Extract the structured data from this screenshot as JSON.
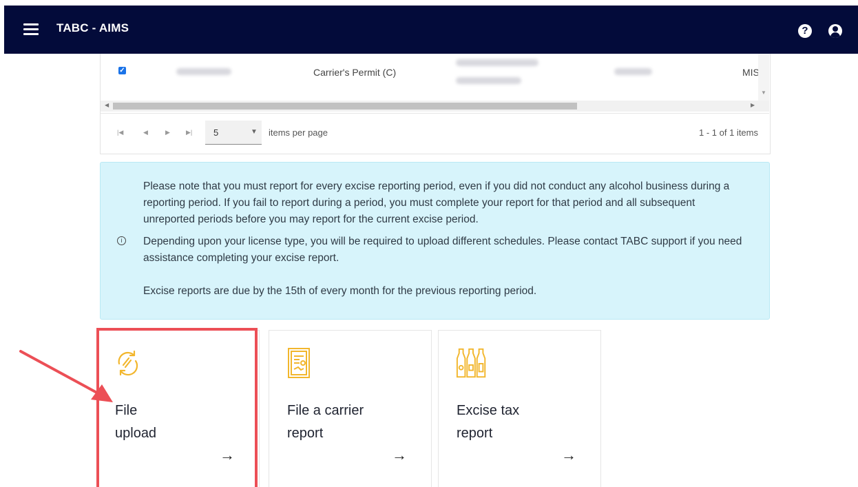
{
  "header": {
    "title": "TABC - AIMS",
    "help_icon": "?",
    "menu_icon": "hamburger-icon",
    "user_icon": "user-circle-icon"
  },
  "grid": {
    "row": {
      "checked": true,
      "permit_type": "Carrier's Permit (C)",
      "truncated_cell": "MIS"
    },
    "pager": {
      "page_size": "5",
      "items_per_page_label": "items per page",
      "count_label": "1 - 1 of 1 items"
    }
  },
  "notice": {
    "paragraphs": [
      "Please note that you must report for every excise reporting period, even if you did not conduct any alcohol business during a reporting period. If you fail to report during a period, you must complete your report for that period and all subsequent unreported periods before you may report for the current excise period.",
      "Depending upon your license type, you will be required to upload different schedules. Please contact TABC support if you need assistance completing your excise report.",
      "Excise reports are due by the 15th of every month for the previous reporting period."
    ]
  },
  "cards": [
    {
      "label": "File upload",
      "icon": "sync-arrows-icon",
      "arrow": "→"
    },
    {
      "label": "File a carrier report",
      "icon": "certificate-icon",
      "arrow": "→"
    },
    {
      "label": "Excise tax report",
      "icon": "bottles-icon",
      "arrow": "→"
    }
  ],
  "colors": {
    "header_bg": "#030b3a",
    "notice_bg": "#d7f4fb",
    "icon_gold": "#f2b62c",
    "highlight_red": "#ec4f56"
  }
}
